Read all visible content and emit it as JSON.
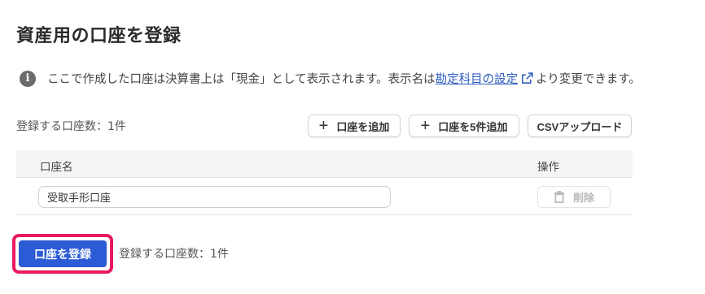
{
  "page": {
    "title": "資産用の口座を登録"
  },
  "notice": {
    "text_before": "ここで作成した口座は決算書上は「現金」として表示されます。表示名は",
    "link_text": "勘定科目の設定",
    "text_after": "より変更できます。",
    "icon": "info-icon",
    "link_icon": "external-link-icon"
  },
  "toolbar": {
    "count_label": "登録する口座数：1件",
    "add_label": "口座を追加",
    "add5_label": "口座を5件追加",
    "csv_label": "CSVアップロード"
  },
  "table": {
    "columns": [
      "口座名",
      "操作"
    ],
    "rows": [
      {
        "name": "受取手形口座",
        "delete_label": "削除"
      }
    ]
  },
  "footer": {
    "register_label": "口座を登録",
    "count_label": "登録する口座数：1件"
  },
  "colors": {
    "primary": "#2c5bd6",
    "highlight": "#e8195e",
    "link": "#2f5dbe"
  }
}
